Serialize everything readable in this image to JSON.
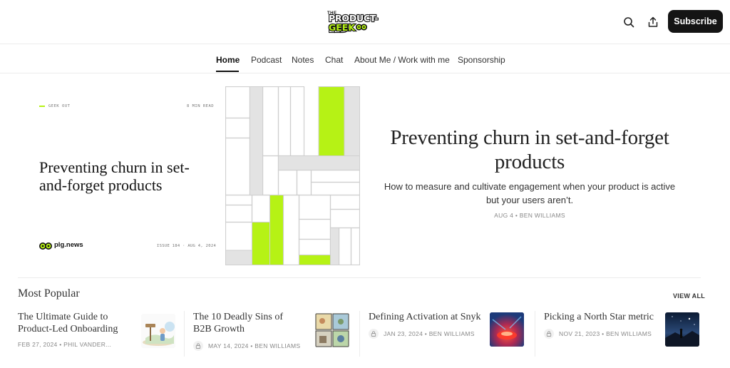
{
  "header": {
    "logo_line1": "THE",
    "logo_line2": "PRODUCT-LED",
    "logo_line3": "GEEK",
    "search_icon": "search-icon",
    "share_icon": "share-icon",
    "subscribe_label": "Subscribe"
  },
  "nav": {
    "items": [
      {
        "label": "Home",
        "active": true
      },
      {
        "label": "Podcast"
      },
      {
        "label": "Notes"
      },
      {
        "label": "Chat"
      },
      {
        "label": "About Me / Work with me"
      },
      {
        "label": "Sponsorship"
      }
    ]
  },
  "featured": {
    "card": {
      "kicker": "GEEK OUT",
      "read_time": "8 MIN READ",
      "title": "Preventing churn in set-and-forget products",
      "brand": "plg.news",
      "issue": "ISSUE 184 · AUG 4, 2024"
    },
    "title": "Preventing churn in set-and-forget products",
    "subtitle": "How to measure and cultivate engagement when your product is active but your users aren’t.",
    "meta": "AUG 4 • BEN WILLIAMS"
  },
  "most_popular": {
    "heading": "Most Popular",
    "view_all": "VIEW ALL",
    "items": [
      {
        "title": "The Ultimate Guide to Product-Led Onboarding",
        "meta": "FEB 27, 2024 • PHIL VANDER...",
        "locked": false
      },
      {
        "title": "The 10 Deadly Sins of B2B Growth",
        "meta": "MAY 14, 2024 • BEN WILLIAMS",
        "locked": true
      },
      {
        "title": "Defining Activation at Snyk",
        "meta": "JAN 23, 2024 • BEN WILLIAMS",
        "locked": true
      },
      {
        "title": "Picking a North Star metric",
        "meta": "NOV 21, 2023 • BEN WILLIAMS",
        "locked": true
      }
    ]
  },
  "colors": {
    "accent_green": "#b6f215",
    "button_dark": "#141414"
  }
}
